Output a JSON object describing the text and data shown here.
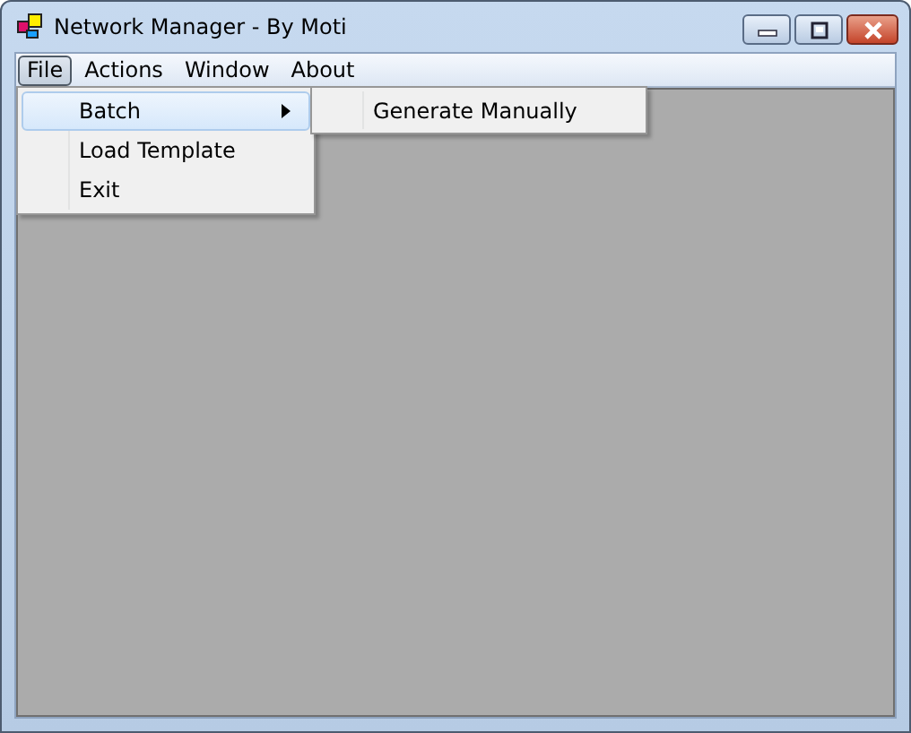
{
  "window": {
    "title": "Network Manager - By Moti"
  },
  "menu_bar": [
    {
      "label": "File",
      "selected": true
    },
    {
      "label": "Actions",
      "selected": false
    },
    {
      "label": "Window",
      "selected": false
    },
    {
      "label": "About",
      "selected": false
    }
  ],
  "file_menu": [
    {
      "label": "Batch",
      "kind": "submenu",
      "selected": true
    },
    {
      "label": "Load Template",
      "kind": "item",
      "selected": false
    },
    {
      "label": "Exit",
      "kind": "item",
      "selected": false
    }
  ],
  "batch_submenu": [
    {
      "label": "Generate Manually",
      "selected": false
    }
  ]
}
